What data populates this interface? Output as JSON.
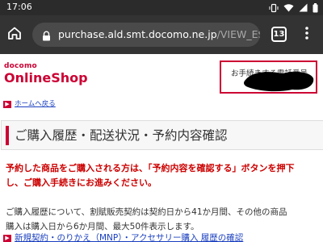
{
  "status_bar": {
    "time": "17:06"
  },
  "browser": {
    "url_host": "purchase.ald.smt.docomo.ne.jp",
    "url_path": "/VIEW_ESITE/ols",
    "tab_count": "13"
  },
  "header": {
    "logo_small": "docomo",
    "logo_main": "OnlineShop",
    "phone_label": "お手続きする電話番号"
  },
  "nav": {
    "back_link": "ホームへ戻る"
  },
  "main": {
    "title": "ご購入履歴・配送状況・予約内容確認",
    "notice_line1": "予約した商品をご購入される方は、「予約内容を確認する」ボタンを押下",
    "notice_line2": "し、ご購入手続きにお進みください。",
    "info_line1": "ご購入履歴について、割賦販売契約は契約日から41か月間、その他の商品",
    "info_line2": "購入は購入日から6か月間、最大50件表示します。",
    "links_text": "新規契約・のりかえ（MNP）・アクセサリー購入 履歴の確認"
  },
  "colors": {
    "brand": "#cc0033",
    "link": "#1a3fbf",
    "notice": "#cc0000"
  }
}
